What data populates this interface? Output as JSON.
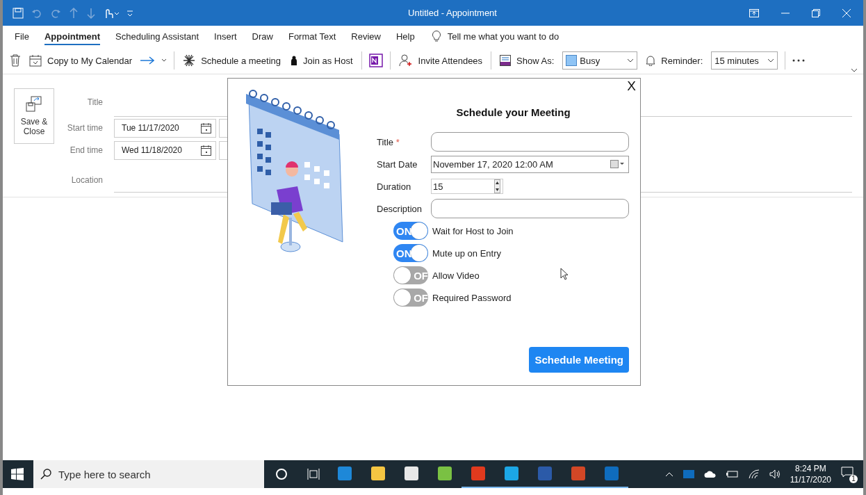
{
  "window": {
    "title": "Untitled  -  Appointment"
  },
  "tabs": [
    {
      "label": "File",
      "selected": false
    },
    {
      "label": "Appointment",
      "selected": true
    },
    {
      "label": "Scheduling Assistant",
      "selected": false
    },
    {
      "label": "Insert",
      "selected": false
    },
    {
      "label": "Draw",
      "selected": false
    },
    {
      "label": "Format Text",
      "selected": false
    },
    {
      "label": "Review",
      "selected": false
    },
    {
      "label": "Help",
      "selected": false
    }
  ],
  "tell_me": "Tell me what you want to do",
  "toolbar": {
    "copy_to_calendar": "Copy to My Calendar",
    "schedule_meeting": "Schedule a meeting",
    "join_as_host": "Join as Host",
    "invite_attendees": "Invite Attendees",
    "show_as_label": "Show As:",
    "show_as_value": "Busy",
    "reminder_label": "Reminder:",
    "reminder_value": "15 minutes"
  },
  "form": {
    "save_close": "Save & Close",
    "title_label": "Title",
    "start_label": "Start time",
    "start_date": "Tue 11/17/2020",
    "end_label": "End time",
    "end_date": "Wed 11/18/2020",
    "location_label": "Location"
  },
  "dialog": {
    "close": "X",
    "heading": "Schedule your Meeting",
    "title_label": "Title",
    "required_mark": "*",
    "start_label": "Start Date",
    "start_value": "November 17, 2020  12:00 AM",
    "duration_label": "Duration",
    "duration_value": "15",
    "description_label": "Description",
    "toggles": [
      {
        "text": "ON",
        "label": "Wait for Host to Join",
        "on": true
      },
      {
        "text": "ON",
        "label": "Mute up on Entry",
        "on": true
      },
      {
        "text": "OF",
        "label": "Allow Video",
        "on": false
      },
      {
        "text": "OF",
        "label": "Required Password",
        "on": false
      }
    ],
    "submit": "Schedule Meeting"
  },
  "taskbar": {
    "search_placeholder": "Type here to search",
    "time": "8:24 PM",
    "date": "11/17/2020",
    "notification_count": "1",
    "apps": [
      {
        "color": "#1e88d8",
        "active": false
      },
      {
        "color": "#f4c542",
        "active": false
      },
      {
        "color": "#e8e8e8",
        "active": false
      },
      {
        "color": "#7ac143",
        "active": false
      },
      {
        "color": "#e03a1e",
        "active": true
      },
      {
        "color": "#1ca7e6",
        "active": true
      },
      {
        "color": "#2b5aa8",
        "active": true
      },
      {
        "color": "#d24726",
        "active": true
      },
      {
        "color": "#0f6cbd",
        "active": true
      }
    ]
  }
}
